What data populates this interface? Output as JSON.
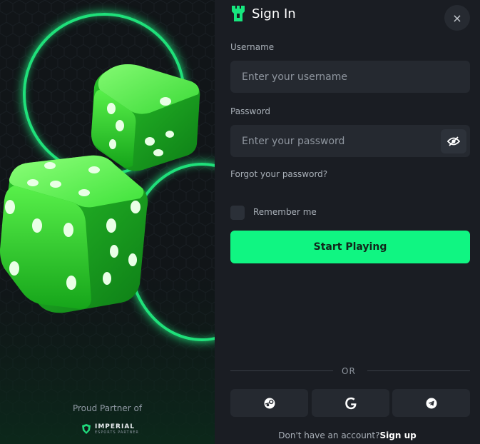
{
  "header": {
    "title": "Sign In",
    "close_label": "×"
  },
  "form": {
    "username_label": "Username",
    "username_placeholder": "Enter your username",
    "password_label": "Password",
    "password_placeholder": "Enter your password",
    "forgot_label": "Forgot your password?",
    "remember_label": "Remember me",
    "remember_checked": false,
    "submit_label": "Start Playing"
  },
  "divider": {
    "label": "OR"
  },
  "social": [
    {
      "name": "steam-icon"
    },
    {
      "name": "google-icon"
    },
    {
      "name": "telegram-icon"
    }
  ],
  "signup": {
    "prompt": "Don't have an account?",
    "link": "Sign up"
  },
  "partner": {
    "label": "Proud Partner of",
    "logo_text": "IMPERIAL",
    "logo_sub": "ESPORTS PARTNER"
  },
  "colors": {
    "accent": "#10f582",
    "panel": "#1a1d23",
    "input": "#252930",
    "ring": "#1fe07a"
  }
}
